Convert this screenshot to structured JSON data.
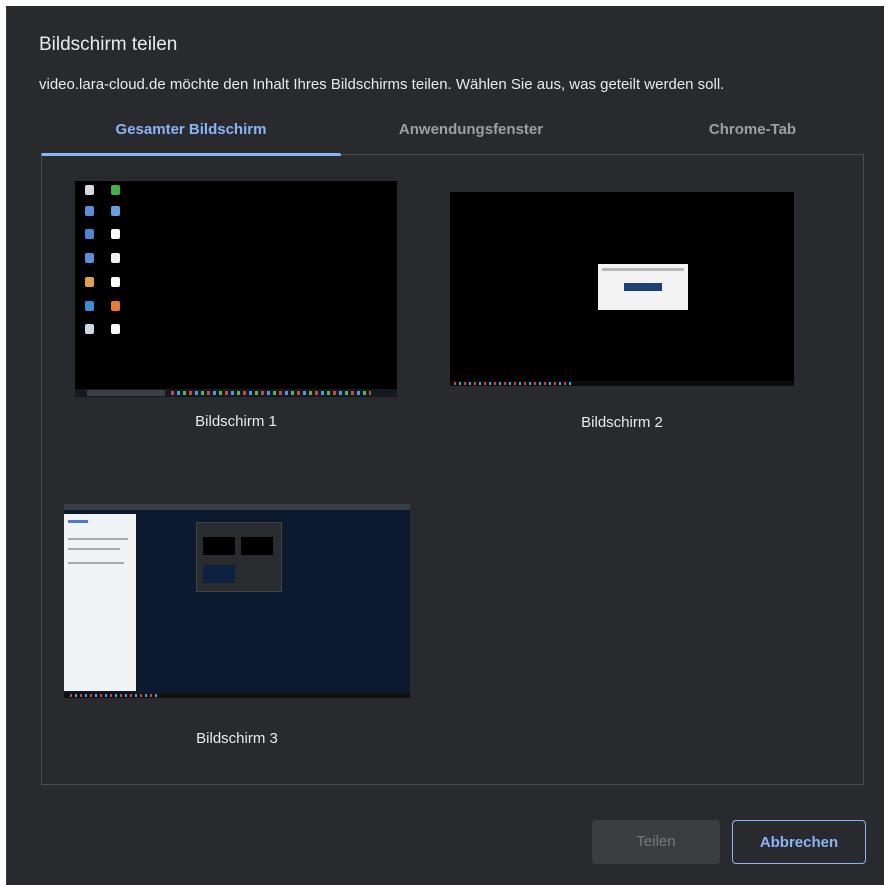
{
  "dialog": {
    "title": "Bildschirm teilen",
    "subtitle": "video.lara-cloud.de möchte den Inhalt Ihres Bildschirms teilen. Wählen Sie aus, was geteilt werden soll."
  },
  "tabs": [
    {
      "label": "Gesamter Bildschirm",
      "active": true
    },
    {
      "label": "Anwendungsfenster",
      "active": false
    },
    {
      "label": "Chrome-Tab",
      "active": false
    }
  ],
  "sources": [
    {
      "label": "Bildschirm 1"
    },
    {
      "label": "Bildschirm 2"
    },
    {
      "label": "Bildschirm 3"
    }
  ],
  "buttons": {
    "share_label": "Teilen",
    "cancel_label": "Abbrechen"
  },
  "colors": {
    "background": "#292a2d",
    "accent": "#8ab4f8",
    "text": "#e8eaed",
    "muted_text": "#9aa0a6",
    "disabled_button": "#3c3d40"
  }
}
